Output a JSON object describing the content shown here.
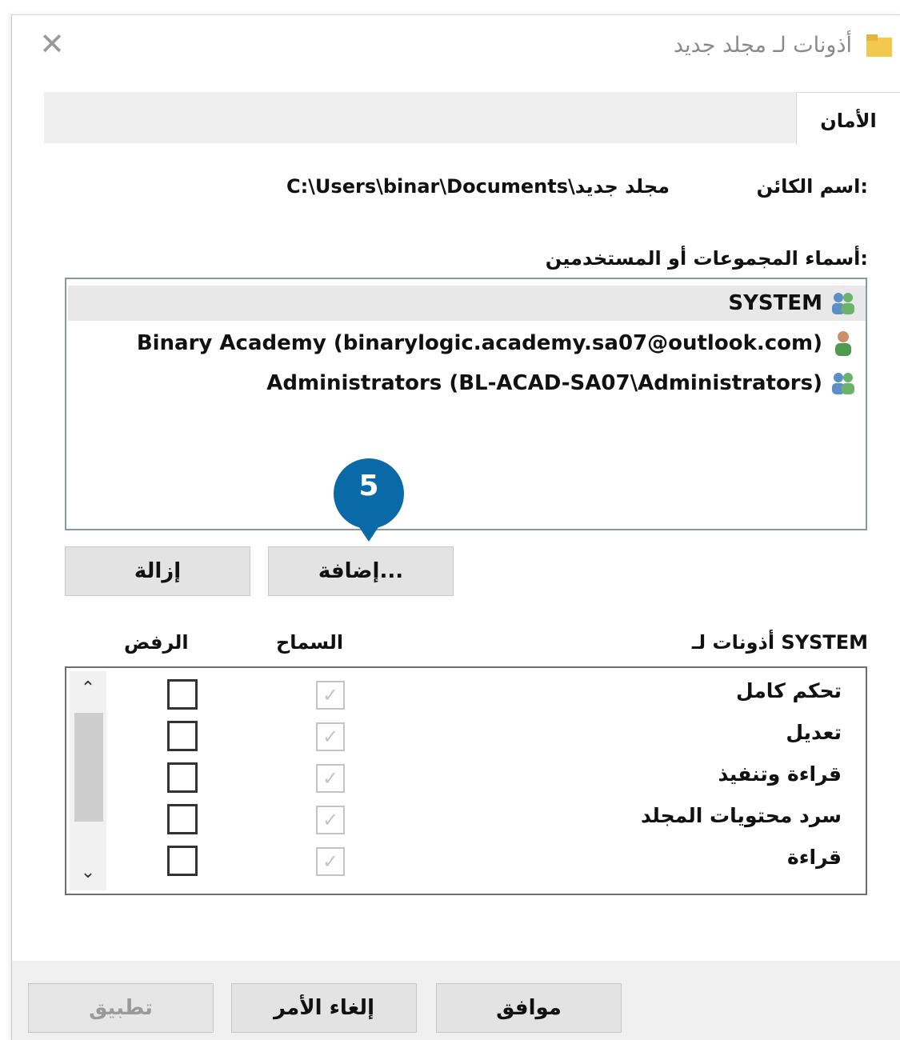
{
  "window": {
    "title": "أذونات لـ مجلد جديد",
    "close_symbol": "✕"
  },
  "tabs": [
    {
      "label": "الأمان",
      "active": true
    }
  ],
  "object": {
    "label": "اسم الكائن:",
    "path": "C:\\Users\\binar\\Documents\\مجلد جديد"
  },
  "groups": {
    "label": "أسماء المجموعات أو المستخدمين:",
    "items": [
      {
        "name": "SYSTEM",
        "icon": "users-group-icon",
        "selected": true
      },
      {
        "name": "Binary Academy (binarylogic.academy.sa07@outlook.com)",
        "icon": "user-icon",
        "selected": false
      },
      {
        "name": "Administrators (BL-ACAD-SA07\\Administrators)",
        "icon": "users-group-icon",
        "selected": false
      }
    ]
  },
  "buttons": {
    "add": "إضافة...",
    "remove": "إزالة",
    "ok": "موافق",
    "cancel": "إلغاء الأمر",
    "apply": "تطبيق"
  },
  "callout": {
    "number": "5",
    "color": "#0a6aa8"
  },
  "permissions": {
    "label": "أذونات لـ SYSTEM",
    "allow_header": "السماح",
    "deny_header": "الرفض",
    "rows": [
      {
        "name": "تحكم كامل",
        "allow": true,
        "deny": false
      },
      {
        "name": "تعديل",
        "allow": true,
        "deny": false
      },
      {
        "name": "قراءة وتنفيذ",
        "allow": true,
        "deny": false
      },
      {
        "name": "سرد محتويات المجلد",
        "allow": true,
        "deny": false
      },
      {
        "name": "قراءة",
        "allow": true,
        "deny": false
      }
    ]
  }
}
